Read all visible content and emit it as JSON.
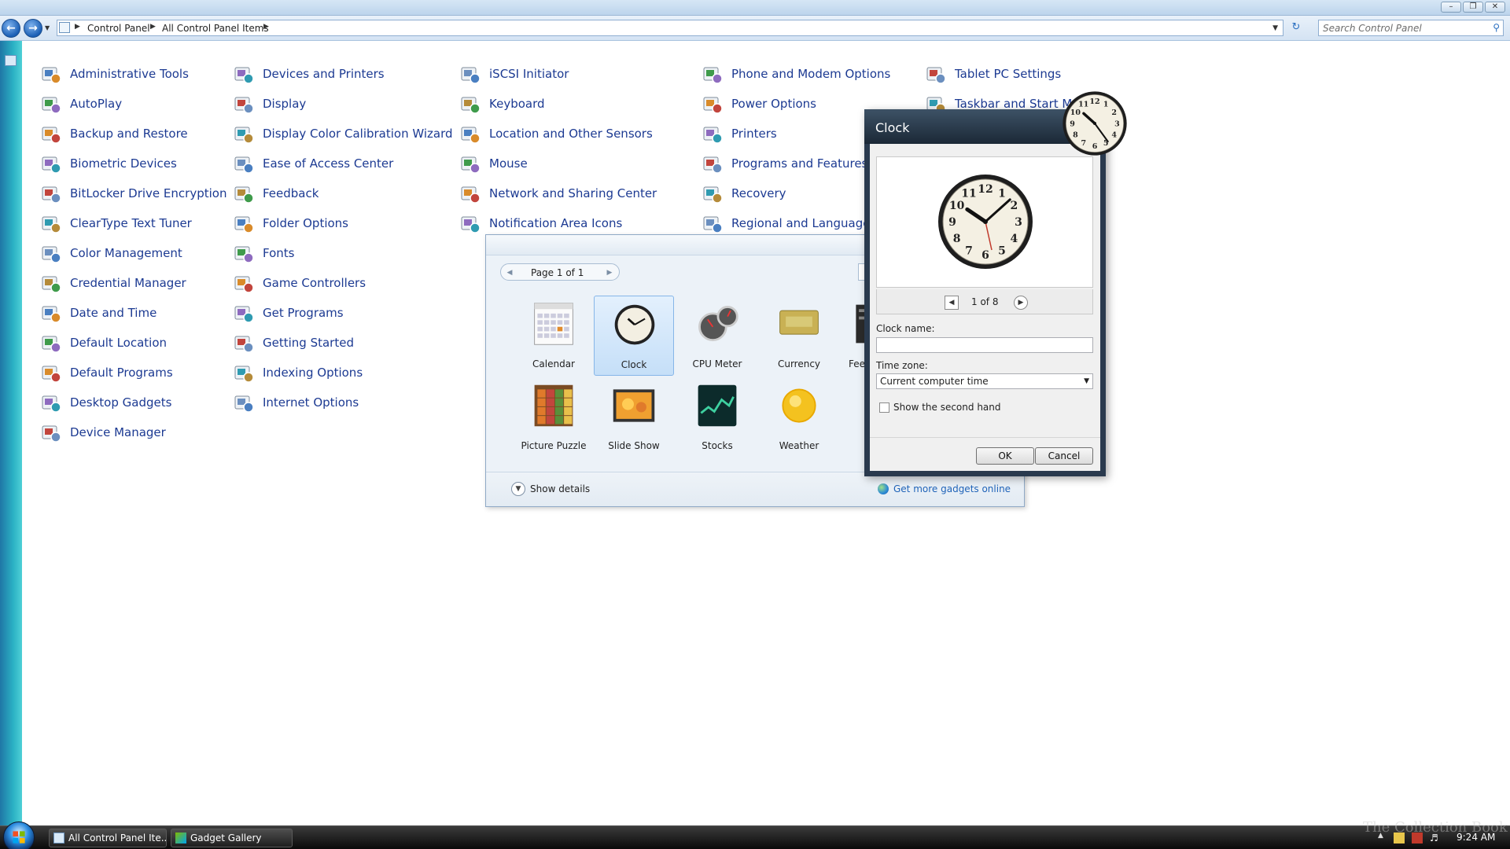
{
  "address": {
    "crumbs": [
      "Control Panel",
      "All Control Panel Items"
    ],
    "search_placeholder": "Search Control Panel"
  },
  "colors": {
    "link": "#1c3a92",
    "accent": "#1f63b8",
    "taskbar": "#1a1a1a"
  },
  "control_panel": {
    "columns": [
      [
        {
          "label": "Administrative Tools",
          "icon": "administrative-tools-icon"
        },
        {
          "label": "AutoPlay",
          "icon": "autoplay-icon"
        },
        {
          "label": "Backup and Restore",
          "icon": "backup-icon"
        },
        {
          "label": "Biometric Devices",
          "icon": "fingerprint-icon"
        },
        {
          "label": "BitLocker Drive Encryption",
          "icon": "bitlocker-icon"
        },
        {
          "label": "ClearType Text Tuner",
          "icon": "cleartype-icon"
        },
        {
          "label": "Color Management",
          "icon": "color-management-icon"
        },
        {
          "label": "Credential Manager",
          "icon": "vault-icon"
        },
        {
          "label": "Date and Time",
          "icon": "calendar-clock-icon"
        },
        {
          "label": "Default Location",
          "icon": "house-icon"
        },
        {
          "label": "Default Programs",
          "icon": "default-programs-icon"
        },
        {
          "label": "Desktop Gadgets",
          "icon": "gadgets-icon"
        },
        {
          "label": "Device Manager",
          "icon": "device-manager-icon"
        }
      ],
      [
        {
          "label": "Devices and Printers",
          "icon": "devices-printers-icon"
        },
        {
          "label": "Display",
          "icon": "monitor-icon"
        },
        {
          "label": "Display Color Calibration Wizard",
          "icon": "color-calibration-icon"
        },
        {
          "label": "Ease of Access Center",
          "icon": "ease-of-access-icon"
        },
        {
          "label": "Feedback",
          "icon": "feedback-icon"
        },
        {
          "label": "Folder Options",
          "icon": "folder-options-icon"
        },
        {
          "label": "Fonts",
          "icon": "fonts-icon"
        },
        {
          "label": "Game Controllers",
          "icon": "gamepad-icon"
        },
        {
          "label": "Get Programs",
          "icon": "get-programs-icon"
        },
        {
          "label": "Getting Started",
          "icon": "getting-started-icon"
        },
        {
          "label": "Indexing Options",
          "icon": "indexing-icon"
        },
        {
          "label": "Internet Options",
          "icon": "internet-options-icon"
        }
      ],
      [
        {
          "label": "iSCSI Initiator",
          "icon": "iscsi-icon"
        },
        {
          "label": "Keyboard",
          "icon": "keyboard-icon"
        },
        {
          "label": "Location and Other Sensors",
          "icon": "sensors-icon"
        },
        {
          "label": "Mouse",
          "icon": "mouse-icon"
        },
        {
          "label": "Network and Sharing Center",
          "icon": "network-icon"
        },
        {
          "label": "Notification Area Icons",
          "icon": "notification-area-icon"
        }
      ],
      [
        {
          "label": "Phone and Modem Options",
          "icon": "phone-modem-icon"
        },
        {
          "label": "Power Options",
          "icon": "power-icon"
        },
        {
          "label": "Printers",
          "icon": "printer-icon"
        },
        {
          "label": "Programs and Features",
          "icon": "programs-features-icon"
        },
        {
          "label": "Recovery",
          "icon": "recovery-icon"
        },
        {
          "label": "Regional and Language",
          "icon": "regional-globe-icon"
        }
      ],
      [
        {
          "label": "Tablet PC Settings",
          "icon": "tablet-pc-icon"
        },
        {
          "label": "Taskbar and Start M",
          "icon": "taskbar-icon"
        }
      ]
    ]
  },
  "gallery": {
    "page_text": "Page 1 of 1",
    "gadgets": [
      {
        "label": "Calendar",
        "icon": "calendar-gadget-icon",
        "selected": false
      },
      {
        "label": "Clock",
        "icon": "clock-gadget-icon",
        "selected": true
      },
      {
        "label": "CPU Meter",
        "icon": "cpu-meter-icon",
        "selected": false
      },
      {
        "label": "Currency",
        "icon": "currency-icon",
        "selected": false
      },
      {
        "label": "Feed",
        "icon": "feed-headlines-icon",
        "selected": false
      },
      {
        "label": "Picture Puzzle",
        "icon": "picture-puzzle-icon",
        "selected": false
      },
      {
        "label": "Slide Show",
        "icon": "slide-show-icon",
        "selected": false
      },
      {
        "label": "Stocks",
        "icon": "stocks-icon",
        "selected": false
      },
      {
        "label": "Weather",
        "icon": "weather-sun-icon",
        "selected": false
      }
    ],
    "show_details": "Show details",
    "more_link": "Get more gadgets online"
  },
  "clock_dialog": {
    "title": "Clock",
    "counter": "1 of 8",
    "name_label": "Clock name:",
    "name_value": "",
    "timezone_label": "Time zone:",
    "timezone_value": "Current computer time",
    "second_hand_label": "Show the second hand",
    "second_hand_checked": false,
    "ok": "OK",
    "cancel": "Cancel",
    "preview_time": {
      "hour": 10,
      "minute": 8
    }
  },
  "desktop_clock_time": {
    "hour": 10,
    "minute": 24
  },
  "taskbar": {
    "items": [
      "All Control Panel Ite...",
      "Gadget Gallery"
    ],
    "time": "9:24 AM"
  },
  "watermark": "The Collection Book"
}
